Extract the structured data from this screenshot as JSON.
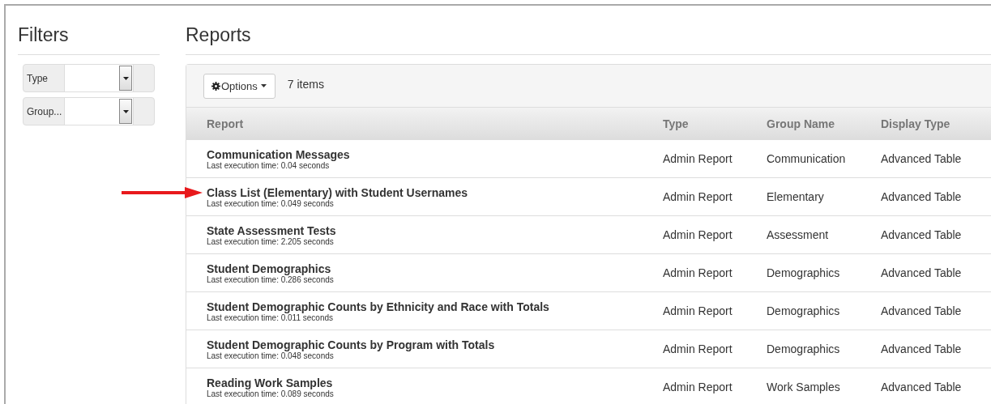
{
  "filters": {
    "title": "Filters",
    "fields": [
      {
        "label": "Type"
      },
      {
        "label": "Group..."
      }
    ]
  },
  "reports": {
    "title": "Reports",
    "options_button": "Options",
    "item_count": "7 items",
    "columns": [
      "Report",
      "Type",
      "Group Name",
      "Display Type"
    ],
    "rows": [
      {
        "name": "Communication Messages",
        "time": "Last execution time: 0.04 seconds",
        "type": "Admin Report",
        "group": "Communication",
        "display": "Advanced Table",
        "arrow": false
      },
      {
        "name": "Class List (Elementary) with Student Usernames",
        "time": "Last execution time: 0.049 seconds",
        "type": "Admin Report",
        "group": "Elementary",
        "display": "Advanced Table",
        "arrow": true
      },
      {
        "name": "State Assessment Tests",
        "time": "Last execution time: 2.205 seconds",
        "type": "Admin Report",
        "group": "Assessment",
        "display": "Advanced Table",
        "arrow": false
      },
      {
        "name": "Student Demographics",
        "time": "Last execution time: 0.286 seconds",
        "type": "Admin Report",
        "group": "Demographics",
        "display": "Advanced Table",
        "arrow": false
      },
      {
        "name": "Student Demographic Counts by Ethnicity and Race with Totals",
        "time": "Last execution time: 0.011 seconds",
        "type": "Admin Report",
        "group": "Demographics",
        "display": "Advanced Table",
        "arrow": false
      },
      {
        "name": "Student Demographic Counts by Program with Totals",
        "time": "Last execution time: 0.048 seconds",
        "type": "Admin Report",
        "group": "Demographics",
        "display": "Advanced Table",
        "arrow": false
      },
      {
        "name": "Reading Work Samples",
        "time": "Last execution time: 0.089 seconds",
        "type": "Admin Report",
        "group": "Work Samples",
        "display": "Advanced Table",
        "arrow": false
      }
    ]
  }
}
